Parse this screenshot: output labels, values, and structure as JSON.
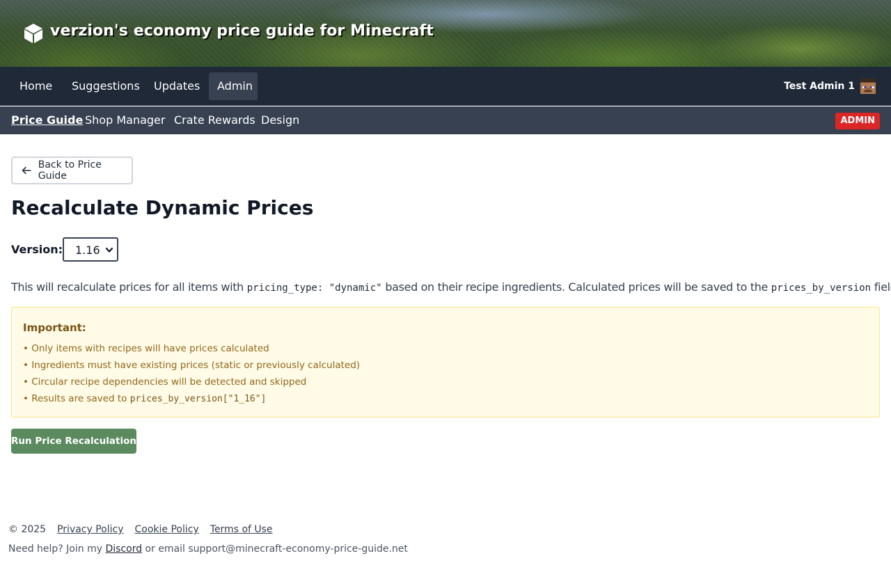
{
  "header": {
    "logo_icon": "cube-icon",
    "title": "verzion's economy price guide for Minecraft"
  },
  "topnav": {
    "items": [
      {
        "label": "Home",
        "active": false
      },
      {
        "label": "Suggestions",
        "active": false
      },
      {
        "label": "Updates",
        "active": false
      },
      {
        "label": "Admin",
        "active": true
      }
    ],
    "user": {
      "name": "Test Admin 1",
      "avatar_icon": "minecraft-head-icon"
    }
  },
  "subnav": {
    "items": [
      {
        "label": "Price Guide",
        "active": true
      },
      {
        "label": "Shop Manager",
        "active": false
      },
      {
        "label": "Crate Rewards",
        "active": false
      },
      {
        "label": "Design",
        "active": false
      }
    ],
    "badge": "ADMIN"
  },
  "main": {
    "back_button": {
      "label": "Back to Price Guide",
      "icon": "arrow-left-icon"
    },
    "title": "Recalculate Dynamic Prices",
    "version": {
      "label": "Version:",
      "selected": "1.16"
    },
    "description": {
      "part1": "This will recalculate prices for all items with ",
      "code1": "pricing_type: \"dynamic\"",
      "part2": " based on their recipe ingredients. Calculated prices will be saved to the ",
      "code2": "prices_by_version",
      "part3": " field."
    },
    "notice": {
      "title": "Important:",
      "items": [
        "• Only items with recipes will have prices calculated",
        "• Ingredients must have existing prices (static or previously calculated)",
        "• Circular recipe dependencies will be detected and skipped"
      ],
      "last_item_text": "• Results are saved to ",
      "last_item_code": "prices_by_version[\"1_16\"]"
    },
    "run_button": "Run Price Recalculation"
  },
  "footer": {
    "copyright": "© 2025",
    "links": [
      "Privacy Policy",
      "Cookie Policy",
      "Terms of Use"
    ],
    "help_prefix": "Need help? Join my ",
    "discord": "Discord",
    "help_suffix": " or email support@minecraft-economy-price-guide.net"
  },
  "colors": {
    "topnav_bg": "#1f2937",
    "subnav_bg": "#374151",
    "admin_badge": "#dc2626",
    "run_button": "#5b8a5e",
    "notice_bg": "#fffbe6"
  }
}
